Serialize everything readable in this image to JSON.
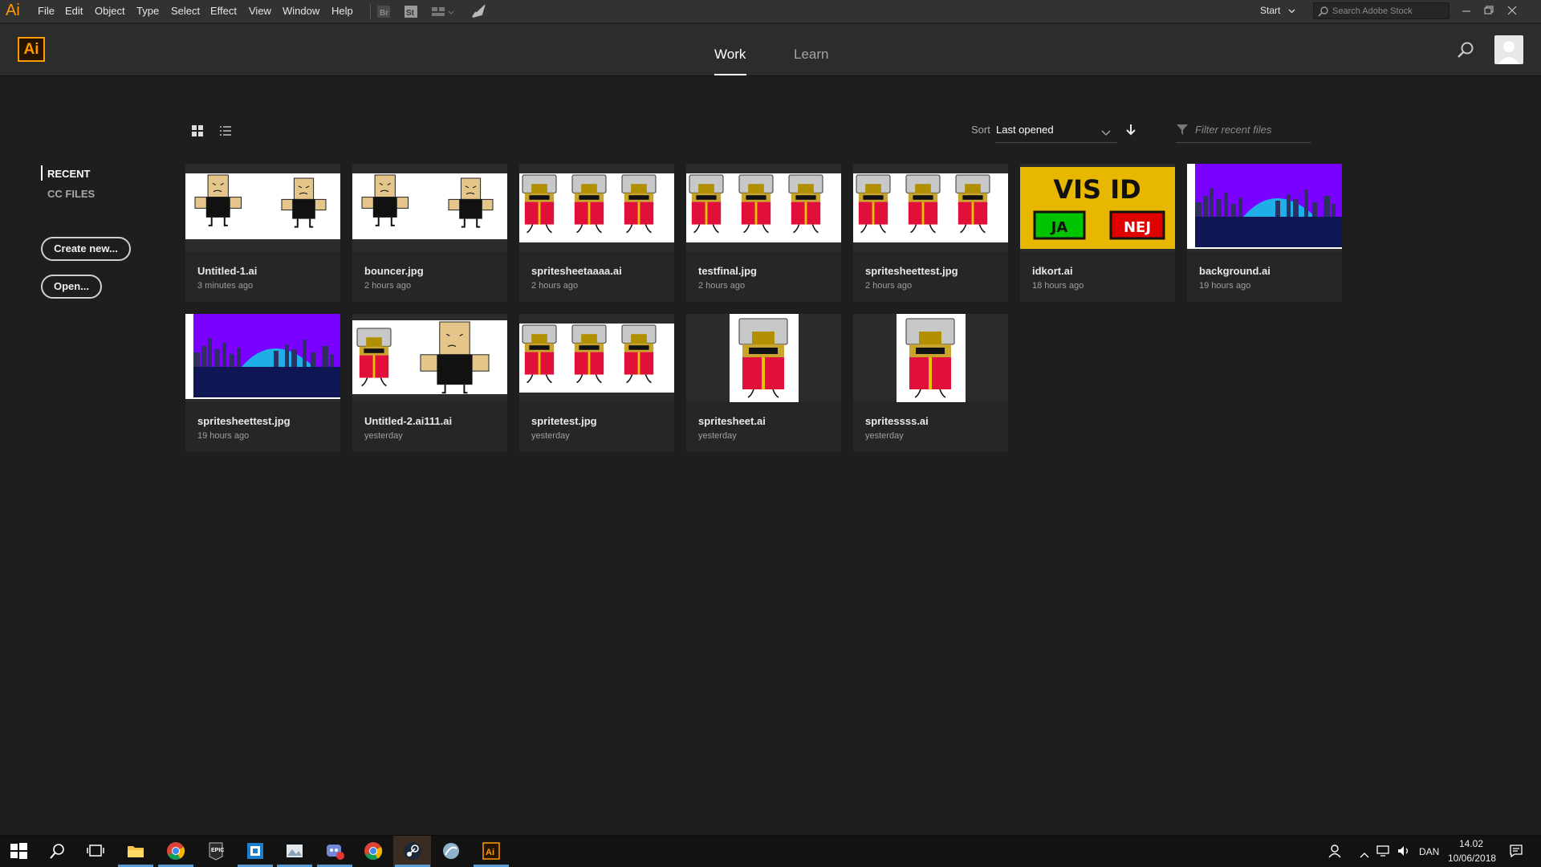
{
  "menubar": {
    "app_logo": "Ai",
    "items": [
      "File",
      "Edit",
      "Object",
      "Type",
      "Select",
      "Effect",
      "View",
      "Window",
      "Help"
    ],
    "workspace": "Start",
    "stock_search_placeholder": "Search Adobe Stock",
    "toolbar_icons": [
      "bridge-icon",
      "stock-icon",
      "arrange-documents-icon",
      "gpu-rocket-icon"
    ]
  },
  "topnav": {
    "logo": "Ai",
    "tabs": [
      {
        "label": "Work",
        "active": true
      },
      {
        "label": "Learn",
        "active": false
      }
    ]
  },
  "sidebar": {
    "recent": "RECENT",
    "cc_files": "CC FILES",
    "create_new": "Create new...",
    "open": "Open..."
  },
  "toolbar": {
    "sort_label": "Sort",
    "sort_value": "Last opened",
    "filter_placeholder": "Filter recent files"
  },
  "files": [
    {
      "name": "Untitled-1.ai",
      "time": "3 minutes ago",
      "thumb": "bouncer"
    },
    {
      "name": "bouncer.jpg",
      "time": "2 hours ago",
      "thumb": "bouncer"
    },
    {
      "name": "spritesheetaaaa.ai",
      "time": "2 hours ago",
      "thumb": "guards"
    },
    {
      "name": "testfinal.jpg",
      "time": "2 hours ago",
      "thumb": "guards"
    },
    {
      "name": "spritesheettest.jpg",
      "time": "2 hours ago",
      "thumb": "guards"
    },
    {
      "name": "idkort.ai",
      "time": "18 hours ago",
      "thumb": "idcard"
    },
    {
      "name": "background.ai",
      "time": "19 hours ago",
      "thumb": "city"
    },
    {
      "name": "spritesheettest.jpg",
      "time": "19 hours ago",
      "thumb": "city"
    },
    {
      "name": "Untitled-2.ai111.ai",
      "time": "yesterday",
      "thumb": "mixed"
    },
    {
      "name": "spritetest.jpg",
      "time": "yesterday",
      "thumb": "guards"
    },
    {
      "name": "spritesheet.ai",
      "time": "yesterday",
      "thumb": "single"
    },
    {
      "name": "spritessss.ai",
      "time": "yesterday",
      "thumb": "single"
    }
  ],
  "idcard": {
    "title": "VIS ID",
    "yes": "JA",
    "no": "NEJ"
  },
  "colors": {
    "accent": "#ff9a00",
    "bg": "#1e1e1e",
    "card": "#262626",
    "city_sky": "#7a00ff",
    "city_ground": "#0f1654"
  },
  "taskbar": {
    "icons": [
      "windows-start-icon",
      "search-icon",
      "task-view-icon",
      "file-explorer-icon",
      "chrome-icon",
      "epic-games-icon",
      "app-icon",
      "photo-app-icon",
      "discord-icon",
      "chrome-icon",
      "steam-icon",
      "app-icon",
      "illustrator-icon"
    ],
    "language": "DAN",
    "time": "14.02",
    "date": "10/06/2018"
  }
}
